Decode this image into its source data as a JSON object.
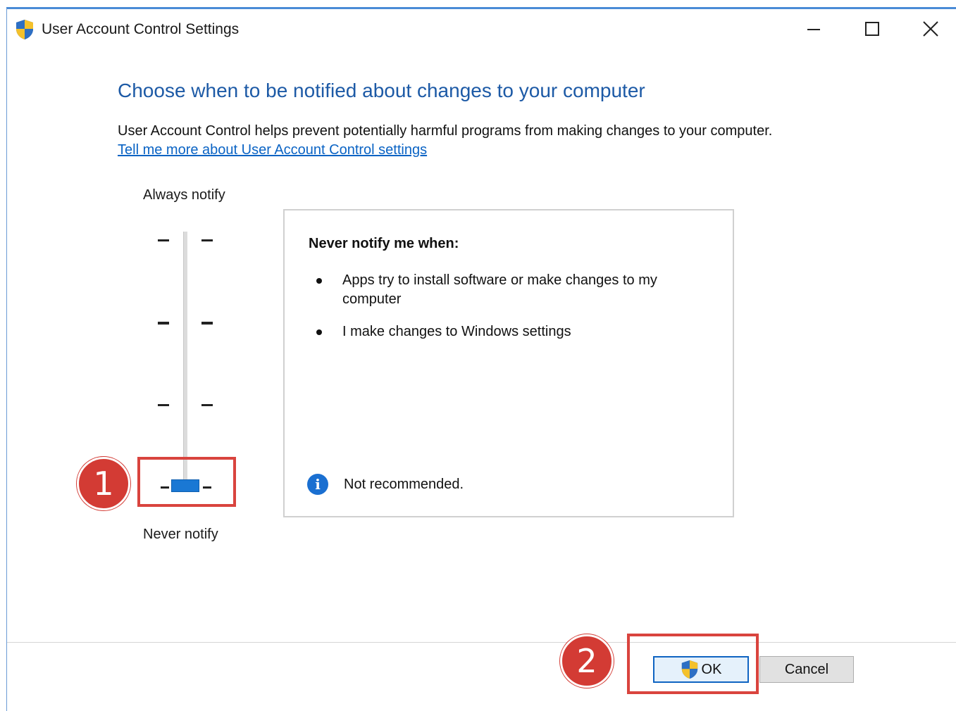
{
  "window": {
    "title": "User Account Control Settings",
    "icon": "uac-shield-icon",
    "controls": {
      "minimize": "minimize-icon",
      "maximize": "maximize-icon",
      "close": "close-icon"
    }
  },
  "main": {
    "heading": "Choose when to be notified about changes to your computer",
    "description": "User Account Control helps prevent potentially harmful programs from making changes to your computer.",
    "link": "Tell me more about User Account Control settings"
  },
  "slider": {
    "top_label": "Always notify",
    "bottom_label": "Never notify",
    "levels": 4,
    "selected_level": 1,
    "selected_description": "Never notify"
  },
  "info_panel": {
    "title": "Never notify me when:",
    "items": [
      "Apps try to install software or make changes to my computer",
      "I make changes to Windows settings"
    ],
    "note_icon": "info-icon",
    "note": "Not recommended."
  },
  "buttons": {
    "ok": "OK",
    "cancel": "Cancel"
  },
  "annotations": {
    "step1": "1",
    "step2": "2"
  },
  "colors": {
    "heading": "#1d5aa6",
    "link": "#0a63c4",
    "highlight": "#d9443e",
    "slider_thumb": "#1a78d4"
  }
}
